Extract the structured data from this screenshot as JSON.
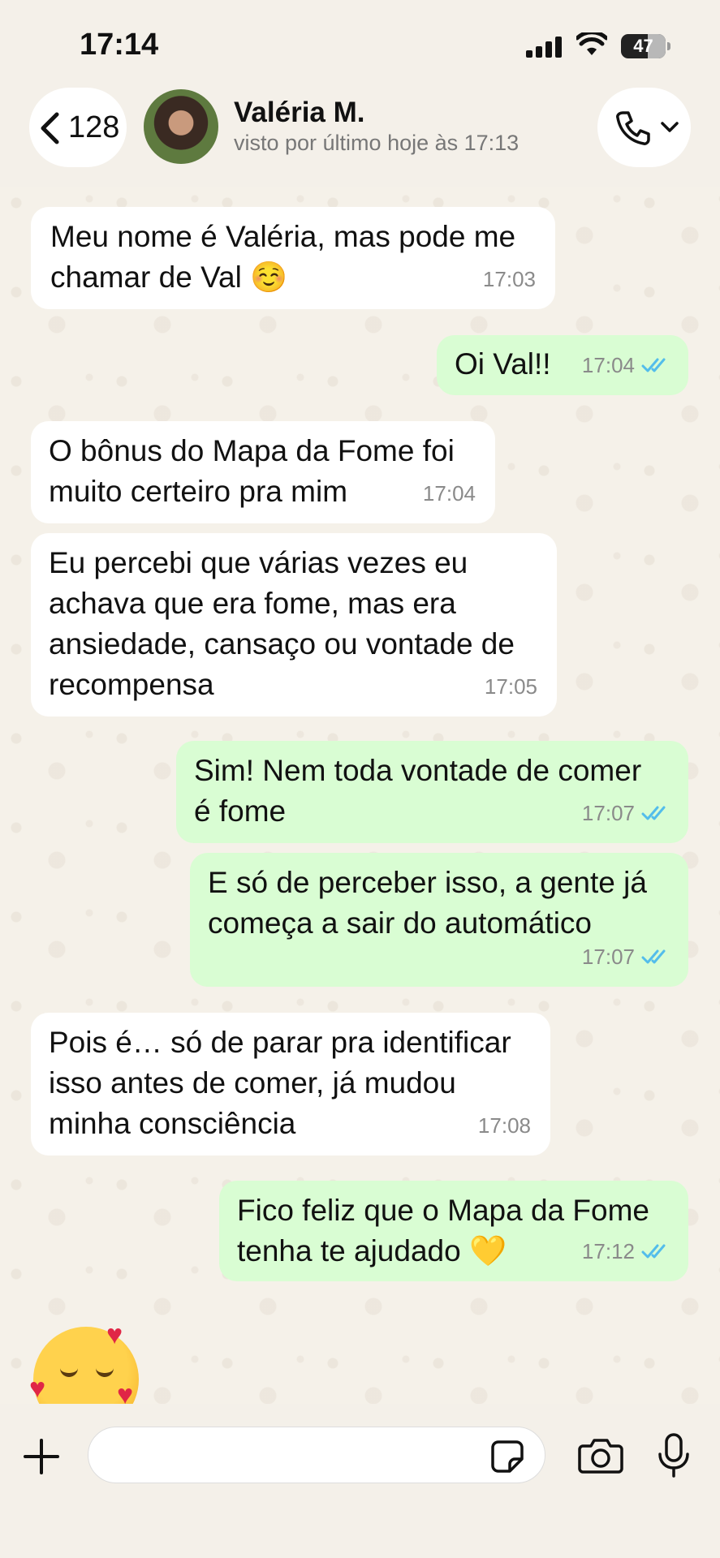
{
  "status_bar": {
    "time": "17:14",
    "battery": "47",
    "battery_level": 0.47
  },
  "header": {
    "back_count": "128",
    "contact_name": "Valéria M.",
    "contact_status": "visto por último hoje às 17:13"
  },
  "messages": [
    {
      "direction": "in",
      "text": "Meu nome é Valéria, mas pode me\nchamar de Val ☺️",
      "time": "17:03"
    },
    {
      "direction": "out",
      "text": "Oi Val!!",
      "time": "17:04",
      "read": true
    },
    {
      "direction": "in",
      "text": "O bônus do Mapa da Fome foi\nmuito certeiro pra mim",
      "time": "17:04"
    },
    {
      "direction": "in",
      "text": "Eu percebi que várias vezes eu\nachava que era fome, mas era\nansiedade, cansaço ou vontade de\nrecompensa",
      "time": "17:05"
    },
    {
      "direction": "out",
      "text": "Sim! Nem toda vontade de comer\né fome",
      "time": "17:07",
      "read": true
    },
    {
      "direction": "out",
      "text": "E só de perceber isso, a gente já\ncomeça a sair do automático",
      "time": "17:07",
      "read": true
    },
    {
      "direction": "in",
      "text": "Pois é… só de parar pra identificar\nisso antes de comer, já mudou\nminha consciência",
      "time": "17:08"
    },
    {
      "direction": "out",
      "text": "Fico feliz que o Mapa da Fome\ntenha te ajudado 💛",
      "time": "17:12",
      "read": true
    }
  ],
  "last_message_emoji": "🥰",
  "composer": {
    "placeholder": ""
  },
  "colors": {
    "incoming": "#ffffff",
    "outgoing": "#d9fdd3",
    "read_tick": "#53bdeb",
    "background": "#f5f1e9"
  },
  "icons": [
    "chevron-left-icon",
    "phone-icon",
    "chevron-down-icon",
    "plus-icon",
    "sticker-icon",
    "camera-icon",
    "microphone-icon",
    "double-check-icon"
  ]
}
